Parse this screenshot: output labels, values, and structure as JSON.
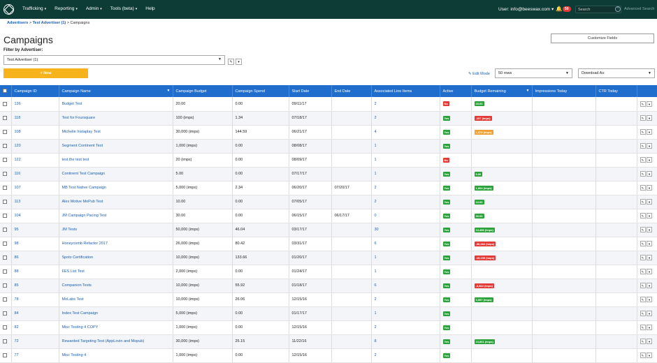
{
  "nav": {
    "items": [
      {
        "label": "Trafficking",
        "caret": "▾"
      },
      {
        "label": "Reporting",
        "caret": "▾"
      },
      {
        "label": "Admin",
        "caret": "▾"
      },
      {
        "label": "Tools (beta)",
        "caret": "▾"
      },
      {
        "label": "Help",
        "caret": ""
      }
    ],
    "user": "User: info@beeswax.com ▾",
    "notification_count": "50",
    "search_placeholder": "Search",
    "advanced_search": "Advanced Search"
  },
  "breadcrumb": {
    "advertisers": "Advertisers",
    "sep1": ">",
    "advertiser": "Test Advertiser (1)",
    "sep2": ">",
    "current": "Campaigns"
  },
  "page": {
    "title": "Campaigns",
    "customize_fields": "Customize Fields",
    "filter_label": "Filter by Advertiser:",
    "filter_value": "Test Advertiser (1)",
    "new_button": "+ New",
    "edit_mode": "Edit Mode",
    "rows_select": "50 rows",
    "download_select": "Download As:"
  },
  "table": {
    "columns": [
      "Campaign ID",
      "Campaign Name",
      "Campaign Budget",
      "Campaign Spend",
      "Start Date",
      "End Date",
      "Associated Line Items",
      "Active",
      "Budget Remaining",
      "Impressions Today",
      "CTR Today"
    ],
    "rows": [
      {
        "id": "136",
        "name": "Budget Test",
        "budget": "20.00",
        "spend": "0.00",
        "start": "09/11/17",
        "end": "",
        "li": "2",
        "active": "No",
        "remaining": "20.00",
        "rem_color": "green"
      },
      {
        "id": "118",
        "name": "Test for Foursquare",
        "budget": "100 (imps)",
        "spend": "1.34",
        "start": "07/18/17",
        "end": "",
        "li": "2",
        "active": "Yes",
        "remaining": "-157 (imps)",
        "rem_color": "red"
      },
      {
        "id": "108",
        "name": "Michelle Instaplay Test",
        "budget": "30,000 (imps)",
        "spend": "144.59",
        "start": "06/21/17",
        "end": "",
        "li": "4",
        "active": "Yes",
        "remaining": "1,575 (imps)",
        "rem_color": "orange"
      },
      {
        "id": "120",
        "name": "Segment Continent Test",
        "budget": "1,000 (imps)",
        "spend": "0.00",
        "start": "08/08/17",
        "end": "",
        "li": "1",
        "active": "Yes",
        "remaining": "",
        "rem_color": ""
      },
      {
        "id": "122",
        "name": "test the test test",
        "budget": "20 (imps)",
        "spend": "0.00",
        "start": "08/09/17",
        "end": "",
        "li": "1",
        "active": "No",
        "remaining": "",
        "rem_color": ""
      },
      {
        "id": "116",
        "name": "Continent Test Campaign",
        "budget": "5.00",
        "spend": "0.00",
        "start": "07/17/17",
        "end": "",
        "li": "1",
        "active": "Yes",
        "remaining": "5.00",
        "rem_color": "green"
      },
      {
        "id": "107",
        "name": "MB Test Native Campaign",
        "budget": "5,000 (imps)",
        "spend": "2.34",
        "start": "06/20/17",
        "end": "07/20/17",
        "li": "2",
        "active": "Yes",
        "remaining": "1,664 (imps)",
        "rem_color": "green"
      },
      {
        "id": "113",
        "name": "Alex Motive MoPub Test",
        "budget": "10.00",
        "spend": "0.00",
        "start": "07/05/17",
        "end": "",
        "li": "2",
        "active": "Yes",
        "remaining": "10.00",
        "rem_color": "green"
      },
      {
        "id": "104",
        "name": "JM Campaign Pacing Test",
        "budget": "30.00",
        "spend": "0.00",
        "start": "06/15/17",
        "end": "06/17/17",
        "li": "0",
        "active": "Yes",
        "remaining": "30.00",
        "rem_color": "green"
      },
      {
        "id": "95",
        "name": "JM Tests",
        "budget": "50,000 (imps)",
        "spend": "46.04",
        "start": "03/17/17",
        "end": "",
        "li": "30",
        "active": "Yes",
        "remaining": "10,456 (imps)",
        "rem_color": "green"
      },
      {
        "id": "98",
        "name": "Honeycomb Refactor 2017",
        "budget": "26,000 (imps)",
        "spend": "80.42",
        "start": "03/31/17",
        "end": "",
        "li": "6",
        "active": "Yes",
        "remaining": "-36,284 (imps)",
        "rem_color": "red"
      },
      {
        "id": "86",
        "name": "Spotx Certification",
        "budget": "10,000 (imps)",
        "spend": "133.66",
        "start": "01/20/17",
        "end": "",
        "li": "1",
        "active": "Yes",
        "remaining": "-15,155 (imps)",
        "rem_color": "red"
      },
      {
        "id": "88",
        "name": "FES List Test",
        "budget": "2,000 (imps)",
        "spend": "0.00",
        "start": "01/24/17",
        "end": "",
        "li": "1",
        "active": "Yes",
        "remaining": "",
        "rem_color": ""
      },
      {
        "id": "85",
        "name": "Companion Tests",
        "budget": "10,000 (imps)",
        "spend": "55.92",
        "start": "01/18/17",
        "end": "",
        "li": "6",
        "active": "Yes",
        "remaining": "-3,364 (imps)",
        "rem_color": "red"
      },
      {
        "id": "78",
        "name": "MoLabs Test",
        "budget": "10,000 (imps)",
        "spend": "26.06",
        "start": "12/15/16",
        "end": "",
        "li": "2",
        "active": "Yes",
        "remaining": "3,957 (imps)",
        "rem_color": "green"
      },
      {
        "id": "84",
        "name": "Index Test Campaign",
        "budget": "5,000 (imps)",
        "spend": "0.00",
        "start": "01/17/17",
        "end": "",
        "li": "1",
        "active": "Yes",
        "remaining": "",
        "rem_color": ""
      },
      {
        "id": "82",
        "name": "Misc Testing 4 COPY",
        "budget": "1,000 (imps)",
        "spend": "0.00",
        "start": "12/15/16",
        "end": "",
        "li": "2",
        "active": "Yes",
        "remaining": "",
        "rem_color": ""
      },
      {
        "id": "72",
        "name": "Rewarded Targeting Test (AppLovin and Mopub)",
        "budget": "30,000 (imps)",
        "spend": "25.15",
        "start": "11/22/16",
        "end": "",
        "li": "8",
        "active": "Yes",
        "remaining": "10,861 (imps)",
        "rem_color": "green"
      },
      {
        "id": "77",
        "name": "Misc Testing 4",
        "budget": "1,000 (imps)",
        "spend": "0.00",
        "start": "12/15/16",
        "end": "",
        "li": "2",
        "active": "Yes",
        "remaining": "",
        "rem_color": ""
      }
    ]
  },
  "colors": {
    "nav": "#0d3b36",
    "header": "#1f6dcd",
    "new_button": "#f6b31b",
    "yes": "#2ca33a",
    "no": "#e53935"
  }
}
